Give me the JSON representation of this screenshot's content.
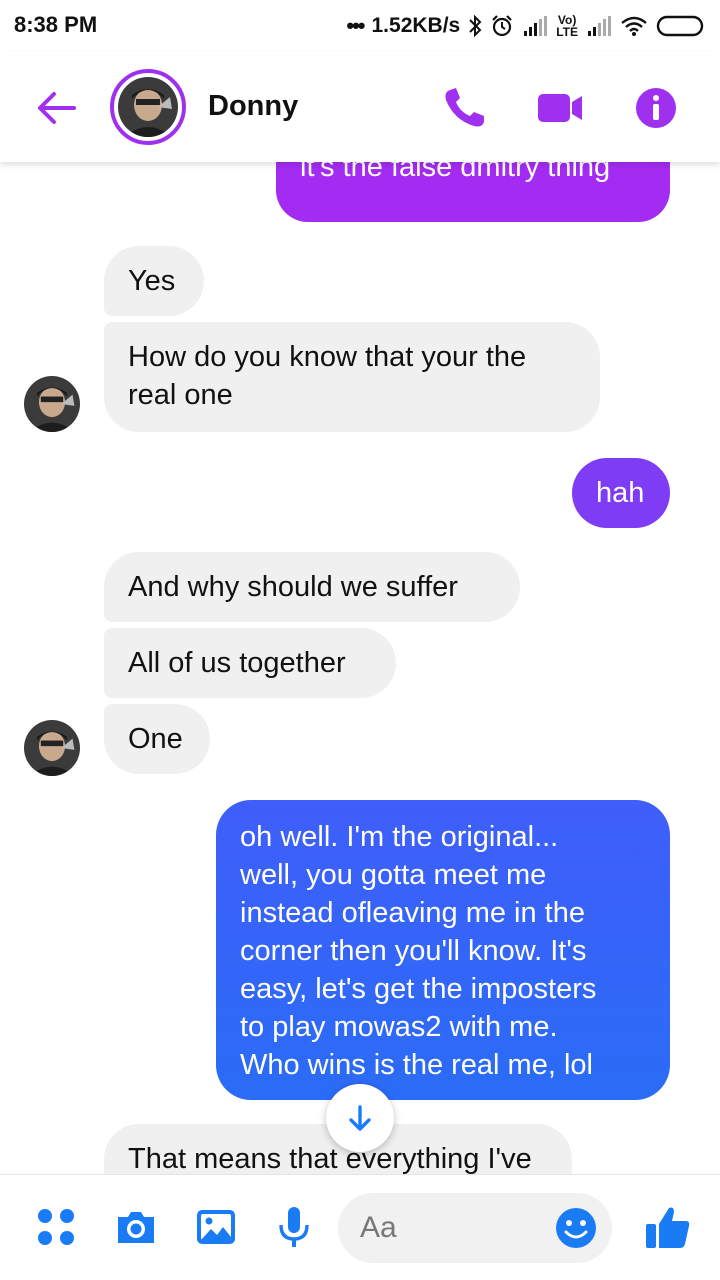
{
  "status_bar": {
    "time": "8:38 PM",
    "network_speed": "1.52KB/s",
    "battery_icon": "battery-icon"
  },
  "header": {
    "contact_name": "Donny",
    "accent_color": "#a030f0"
  },
  "messages": [
    {
      "sender": "me",
      "text": "it's the false dmitry thing",
      "color": "#a42cf2"
    },
    {
      "sender": "them",
      "text": "Yes"
    },
    {
      "sender": "them",
      "lines": [
        "How do you know that your the",
        "real one"
      ]
    },
    {
      "sender": "me",
      "text": "hah",
      "color": "#7e3cf5"
    },
    {
      "sender": "them",
      "text": "And why should we suffer"
    },
    {
      "sender": "them",
      "text": "All of us together"
    },
    {
      "sender": "them",
      "text": "One"
    },
    {
      "sender": "me",
      "lines": [
        "oh well. I'm the original...",
        "well, you gotta meet me",
        "instead ofleaving me in the",
        "corner then you'll know. It's",
        "easy, let's get the imposters",
        "to play mowas2 with me.",
        "Who wins is the real me, lol"
      ],
      "color": "#3f5efa"
    },
    {
      "sender": "them",
      "text": "That means that everything I've"
    }
  ],
  "composer": {
    "placeholder": "Aa",
    "icon_color": "#1a7cf5"
  }
}
